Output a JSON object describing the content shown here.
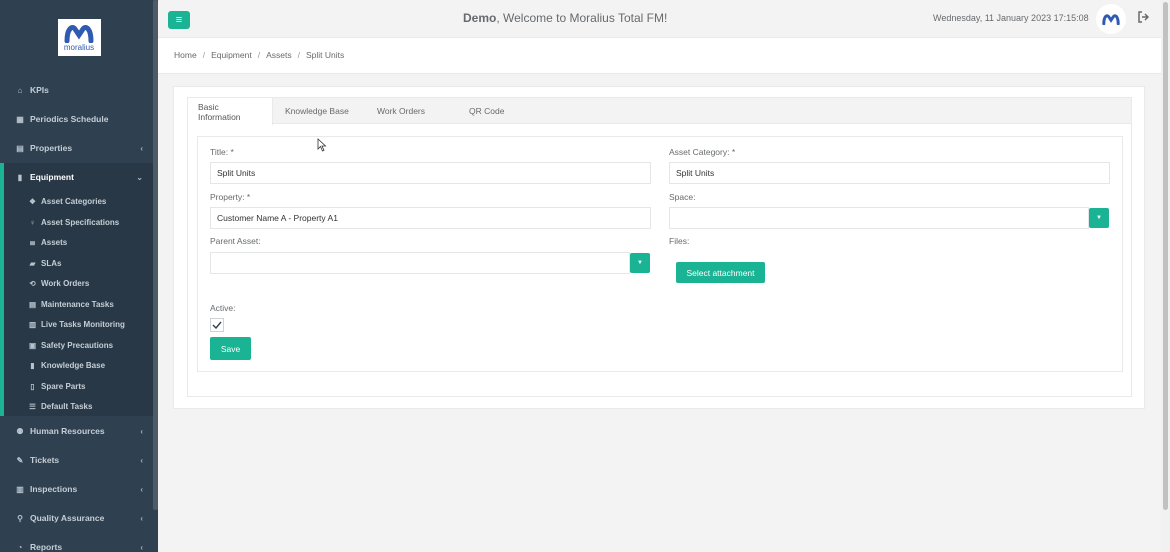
{
  "app": {
    "logo_text": "moralius",
    "welcome_name": "Demo",
    "welcome_rest": ", Welcome to Moralius Total FM!",
    "datetime": "Wednesday, 11 January 2023 17:15:08"
  },
  "sidebar": {
    "items": [
      {
        "label": "KPIs",
        "icon": "home-icon"
      },
      {
        "label": "Periodics Schedule",
        "icon": "calendar-icon"
      },
      {
        "label": "Properties",
        "icon": "building-icon"
      },
      {
        "label": "Equipment",
        "icon": "document-icon"
      },
      {
        "label": "Human Resources",
        "icon": "users-icon"
      },
      {
        "label": "Tickets",
        "icon": "tools-icon"
      },
      {
        "label": "Inspections",
        "icon": "map-icon"
      },
      {
        "label": "Quality Assurance",
        "icon": "search-icon"
      },
      {
        "label": "Reports",
        "icon": "chart-icon"
      }
    ],
    "equipment_sub": [
      {
        "label": "Asset Categories",
        "icon": "cubes-icon"
      },
      {
        "label": "Asset Specifications",
        "icon": "lightbulb-icon"
      },
      {
        "label": "Assets",
        "icon": "list-icon"
      },
      {
        "label": "SLAs",
        "icon": "truck-icon"
      },
      {
        "label": "Work Orders",
        "icon": "refresh-icon"
      },
      {
        "label": "Maintenance Tasks",
        "icon": "list-alt-icon"
      },
      {
        "label": "Live Tasks Monitoring",
        "icon": "map-icon"
      },
      {
        "label": "Safety Precautions",
        "icon": "briefcase-icon"
      },
      {
        "label": "Knowledge Base",
        "icon": "book-icon"
      },
      {
        "label": "Spare Parts",
        "icon": "file-icon"
      },
      {
        "label": "Default Tasks",
        "icon": "tasks-icon"
      }
    ]
  },
  "breadcrumb": [
    "Home",
    "Equipment",
    "Assets",
    "Split Units"
  ],
  "tabs": [
    "Basic Information",
    "Knowledge Base",
    "Work Orders",
    "QR Code"
  ],
  "form": {
    "title_label": "Title: *",
    "title_value": "Split Units",
    "category_label": "Asset Category: *",
    "category_value": "Split Units",
    "property_label": "Property: *",
    "property_value": "Customer Name A - Property A1",
    "space_label": "Space:",
    "space_value": "",
    "parent_label": "Parent Asset:",
    "parent_value": "",
    "files_label": "Files:",
    "attach_button": "Select attachment",
    "active_label": "Active:",
    "active_checked": true,
    "save_button": "Save"
  },
  "colors": {
    "sidebar_bg": "#2f4050",
    "accent": "#1ab394"
  }
}
